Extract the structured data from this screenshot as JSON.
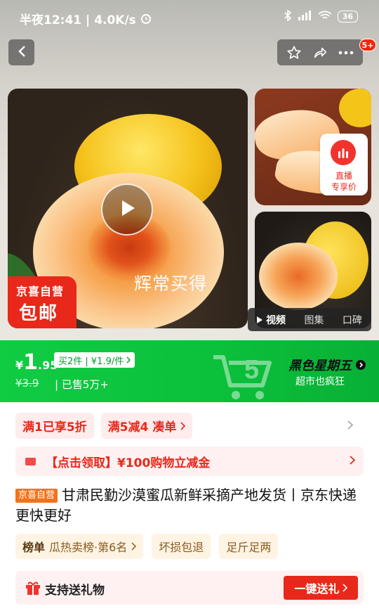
{
  "status_bar": {
    "time": "半夜12:41",
    "speed": "4.0K/s",
    "battery": "36"
  },
  "header": {
    "badge": "5+"
  },
  "gallery": {
    "slogan": "辉常买得",
    "badge_line1": "京喜自营",
    "badge_line2": "包邮",
    "live_label1": "直播",
    "live_label2": "专享价",
    "tabs": [
      "视频",
      "图集",
      "口碑"
    ]
  },
  "price_banner": {
    "currency": "¥",
    "price_int": "1",
    "price_dec": ".95",
    "buy2_tag": "买2件 | ¥1.9/件",
    "original_price": "¥3.9",
    "sold": "已售5万+",
    "event_title": "黑色星期五",
    "event_sub": "超市也疯狂",
    "colors": {
      "banner": "#10cc43",
      "event_title": "#111111"
    }
  },
  "promotions": {
    "tags": [
      "满1已享5折",
      "满5减4",
      "凑单"
    ],
    "coupon": "【点击领取】¥100购物立减金"
  },
  "product": {
    "self_tag": "京喜自营",
    "title": "甘肃民勤沙漠蜜瓜新鲜采摘产地发货丨京东快递 更快更好"
  },
  "tags": {
    "rank_label": "榜单",
    "rank_value": "瓜热卖榜·第6名",
    "guarantee1": "坏损包退",
    "guarantee2": "足斤足两"
  },
  "gift": {
    "label": "支持送礼物",
    "button": "一键送礼"
  },
  "colors": {
    "accent": "#e8281a",
    "green": "#10cc43"
  }
}
